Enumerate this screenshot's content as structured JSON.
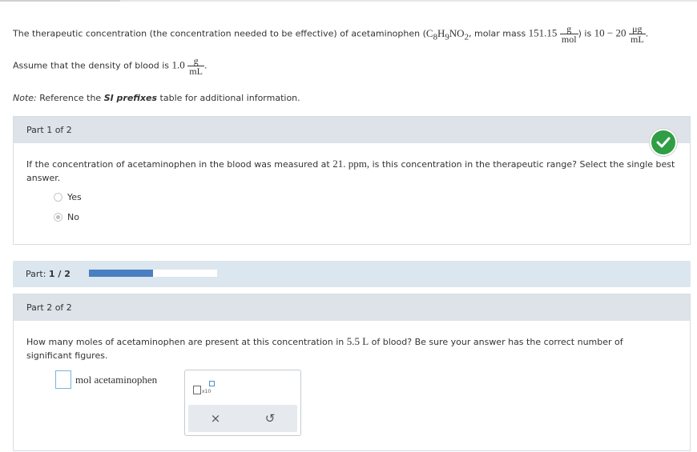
{
  "intro": {
    "t1": "The therapeutic concentration (the concentration needed to be effective) of acetaminophen (",
    "formula_c": "C",
    "formula_c_sub": "8",
    "formula_h": "H",
    "formula_h_sub": "9",
    "formula_no": "NO",
    "formula_no_sub": "2",
    "t2": ", molar mass ",
    "molar_mass": "151.15",
    "mm_num": "g",
    "mm_den": "mol",
    "t3": ") is ",
    "range": "10 − 20",
    "conc_num": "μg",
    "conc_den": "mL",
    "t4": ".",
    "density_text": "Assume that the density of blood is ",
    "density_value": "1.0",
    "density_num": "g",
    "density_den": "mL",
    "note_prefix": "Note:",
    "note_mid": " Reference the ",
    "note_bold": "SI prefixes",
    "note_suffix": " table for additional information."
  },
  "part1": {
    "header": "Part 1 of 2",
    "question_a": "If the concentration of acetaminophen in the blood was measured at ",
    "value": "21. ppm,",
    "question_b": " is this concentration in the therapeutic range? Select the single best answer.",
    "options": [
      {
        "label": "Yes",
        "selected": false
      },
      {
        "label": "No",
        "selected": true
      }
    ],
    "status_icon": "checkmark-icon",
    "status_color": "#2f9e44"
  },
  "progress": {
    "label": "Part:",
    "value": "1 / 2",
    "fraction": 0.5,
    "color": "#4a7fc1"
  },
  "part2": {
    "header": "Part 2 of 2",
    "question_a": "How many moles of acetaminophen are present at this concentration in ",
    "volume": "5.5 L",
    "question_b": " of blood? Be sure your answer has the correct number of significant figures.",
    "answer_value": "",
    "unit": "mol acetaminophen",
    "tool_x10": "x10",
    "clear": "×",
    "undo": "↺"
  }
}
